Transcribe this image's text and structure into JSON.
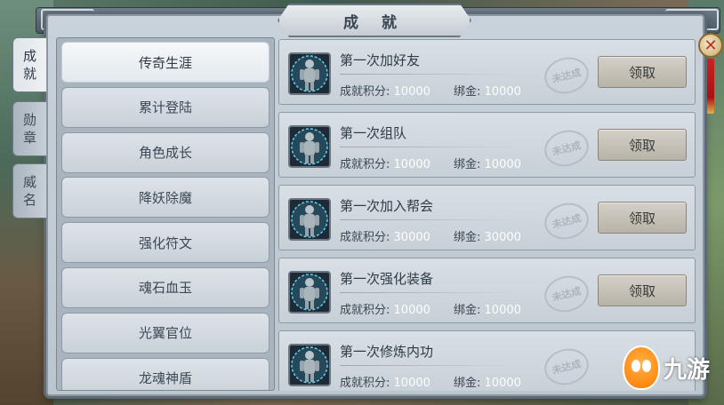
{
  "window": {
    "title": "成 就"
  },
  "side_tabs": [
    {
      "label": "成\n就",
      "chars": [
        "成",
        "就"
      ],
      "active": true
    },
    {
      "label": "勋\n章",
      "chars": [
        "勋",
        "章"
      ],
      "active": false
    },
    {
      "label": "威\n名",
      "chars": [
        "威",
        "名"
      ],
      "active": false
    }
  ],
  "categories": [
    {
      "label": "传奇生涯",
      "active": true
    },
    {
      "label": "累计登陆",
      "active": false
    },
    {
      "label": "角色成长",
      "active": false
    },
    {
      "label": "降妖除魔",
      "active": false
    },
    {
      "label": "强化符文",
      "active": false
    },
    {
      "label": "魂石血玉",
      "active": false
    },
    {
      "label": "光翼官位",
      "active": false
    },
    {
      "label": "龙魂神盾",
      "active": false
    }
  ],
  "labels": {
    "points": "成就积分:",
    "gold": "绑金:",
    "stamp": "未达成",
    "claim": "领取"
  },
  "achievements": [
    {
      "title": "第一次加好友",
      "points": "10000",
      "gold": "10000"
    },
    {
      "title": "第一次组队",
      "points": "10000",
      "gold": "10000"
    },
    {
      "title": "第一次加入帮会",
      "points": "30000",
      "gold": "30000"
    },
    {
      "title": "第一次强化装备",
      "points": "10000",
      "gold": "10000"
    },
    {
      "title": "第一次修炼内功",
      "points": "10000",
      "gold": "10000"
    }
  ],
  "close": {
    "symbol": "✕"
  },
  "watermark": {
    "text": "九游"
  },
  "colors": {
    "accent": "#b8331f",
    "value_text": "#fdfdfd"
  }
}
